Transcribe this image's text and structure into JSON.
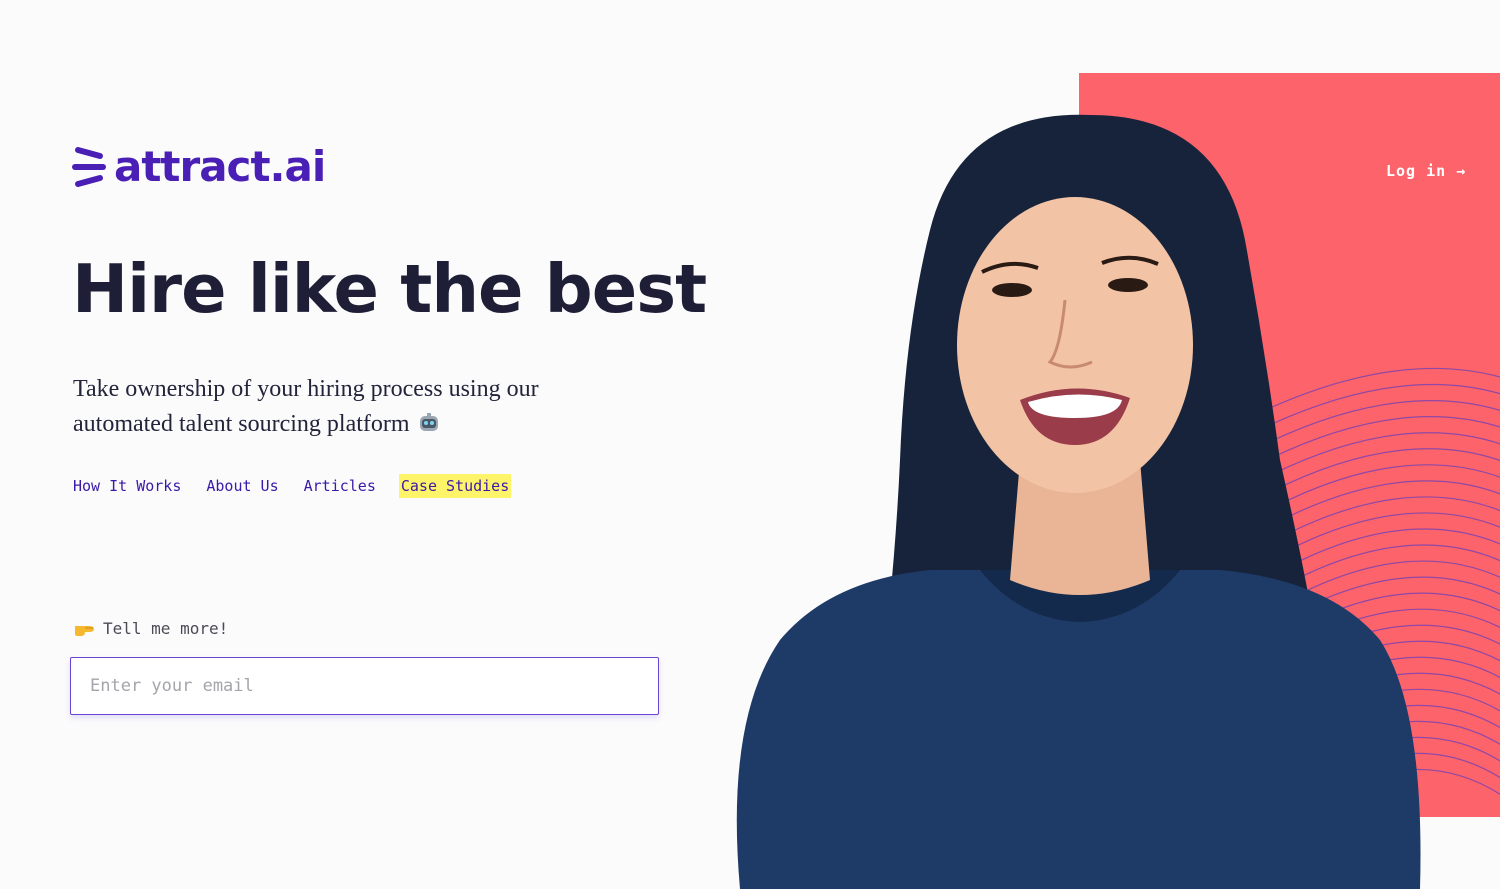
{
  "brand": {
    "name": "attract.ai",
    "color": "#4a1fb5",
    "accent": "#fd636b",
    "highlight": "#fef46a"
  },
  "header": {
    "login_label": "Log in →"
  },
  "hero": {
    "headline": "Hire like the best",
    "subheadline": "Take ownership of your hiring process using our automated talent sourcing platform",
    "subheadline_icon": "robot-icon"
  },
  "nav": {
    "items": [
      {
        "label": "How It Works"
      },
      {
        "label": "About Us"
      },
      {
        "label": "Articles"
      },
      {
        "label": "Case Studies",
        "highlighted": true
      }
    ]
  },
  "signup": {
    "prompt_icon": "pointing-hand-icon",
    "prompt": "Tell me more!",
    "email_placeholder": "Enter your email",
    "email_value": ""
  }
}
